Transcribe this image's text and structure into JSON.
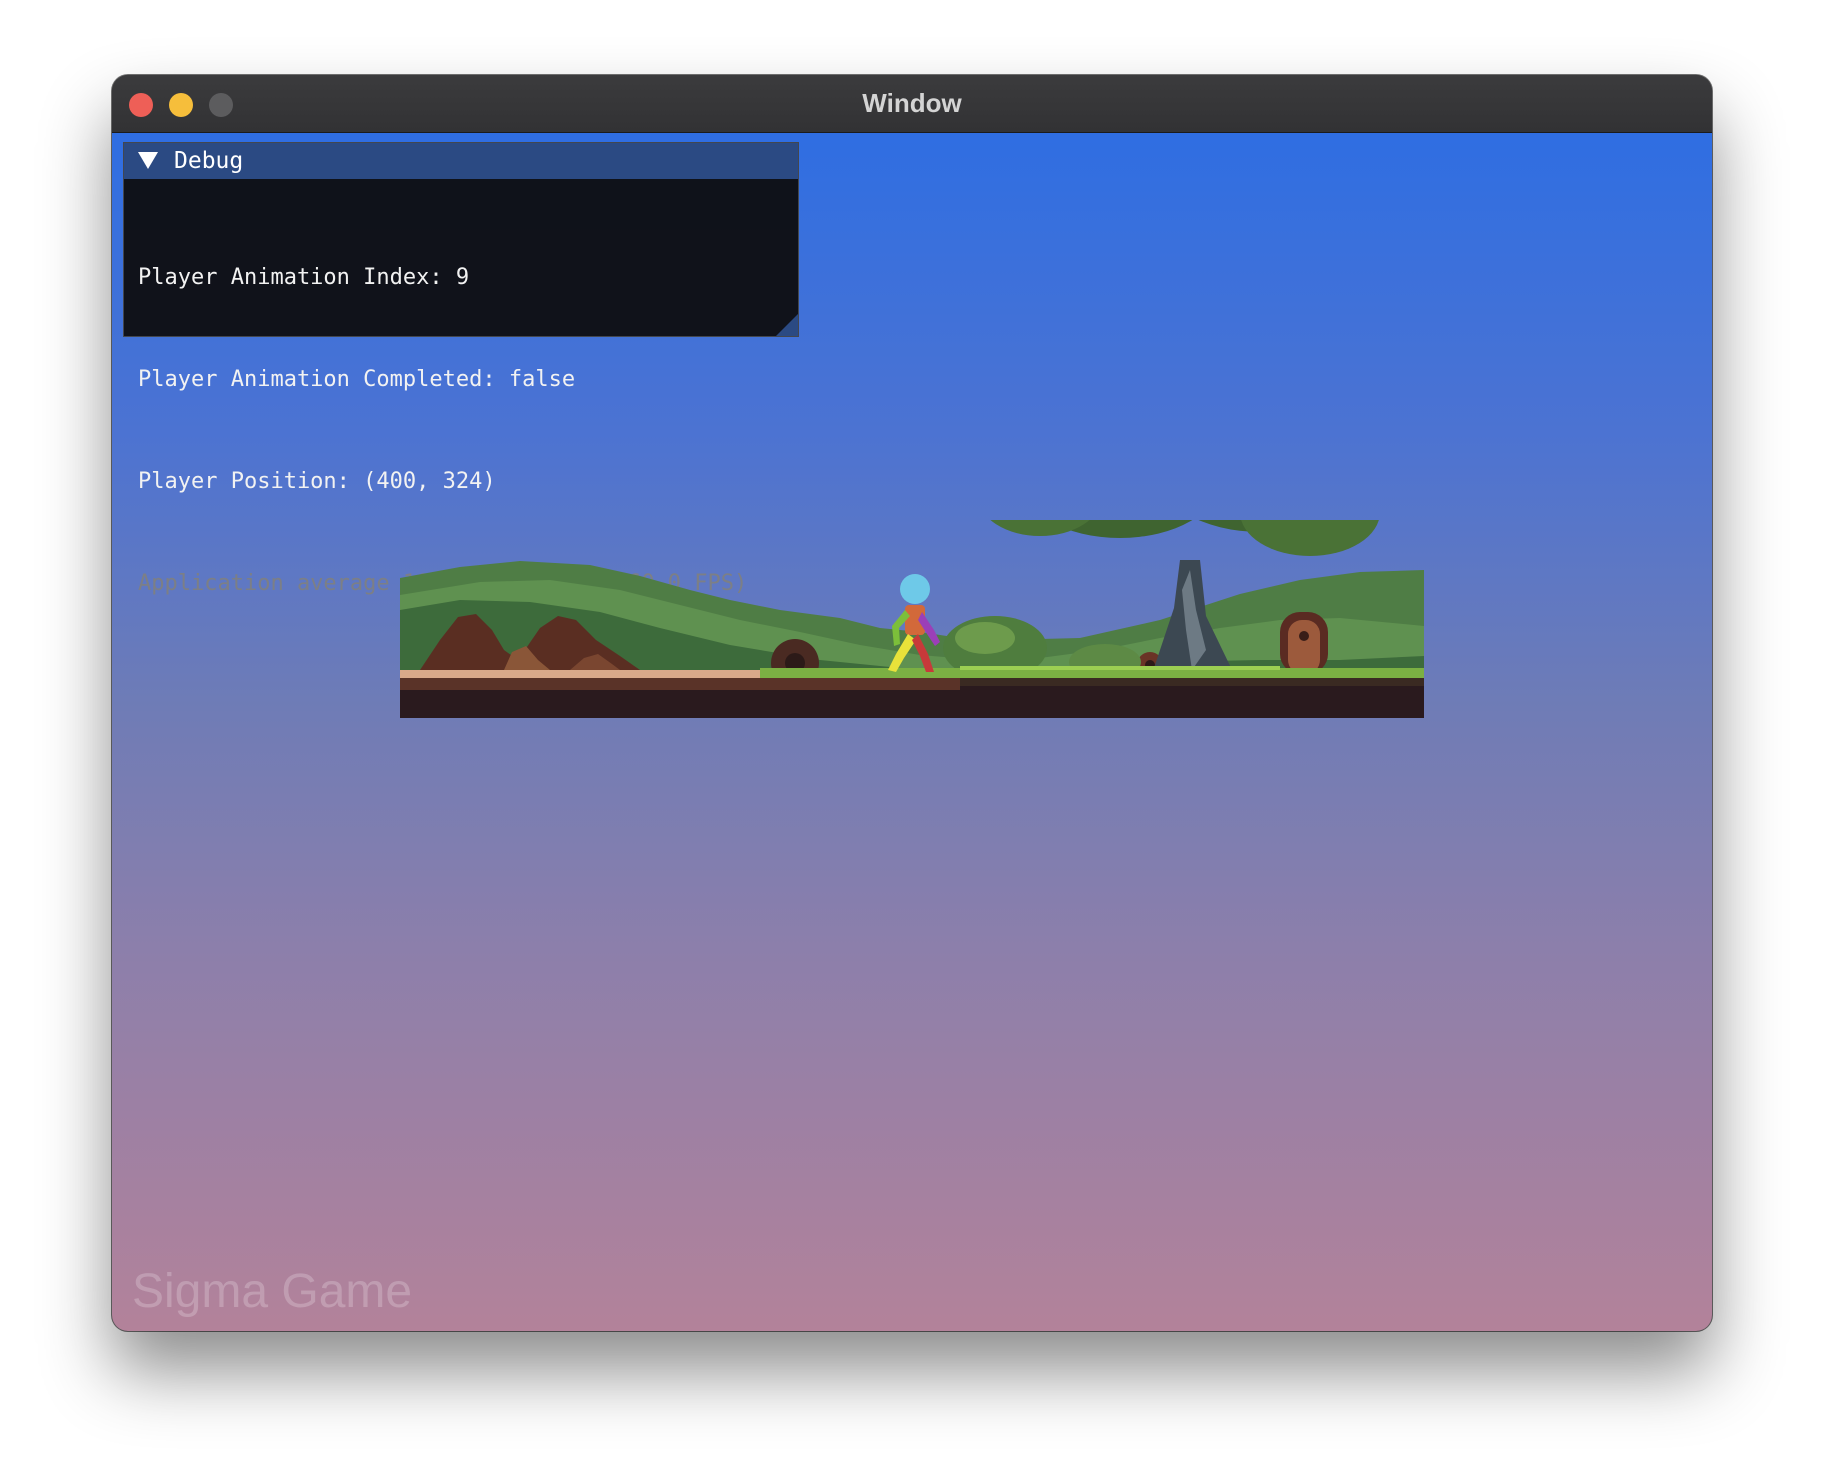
{
  "window": {
    "title": "Window",
    "controls": [
      "close",
      "minimize",
      "maximize"
    ]
  },
  "debug_panel": {
    "title": "Debug",
    "lines": {
      "animation_index": "Player Animation Index: 9",
      "animation_completed": "Player Animation Completed: false",
      "player_position": "Player Position: (400, 324)",
      "fps": "Application average 16.663 ms/frame (60.0 FPS)"
    }
  },
  "watermark": "Sigma Game",
  "colors": {
    "sky_top": "#2f6ee2",
    "sky_bottom": "#b3829a",
    "panel_header": "#2b4a83",
    "panel_bg": "#0e1014"
  }
}
